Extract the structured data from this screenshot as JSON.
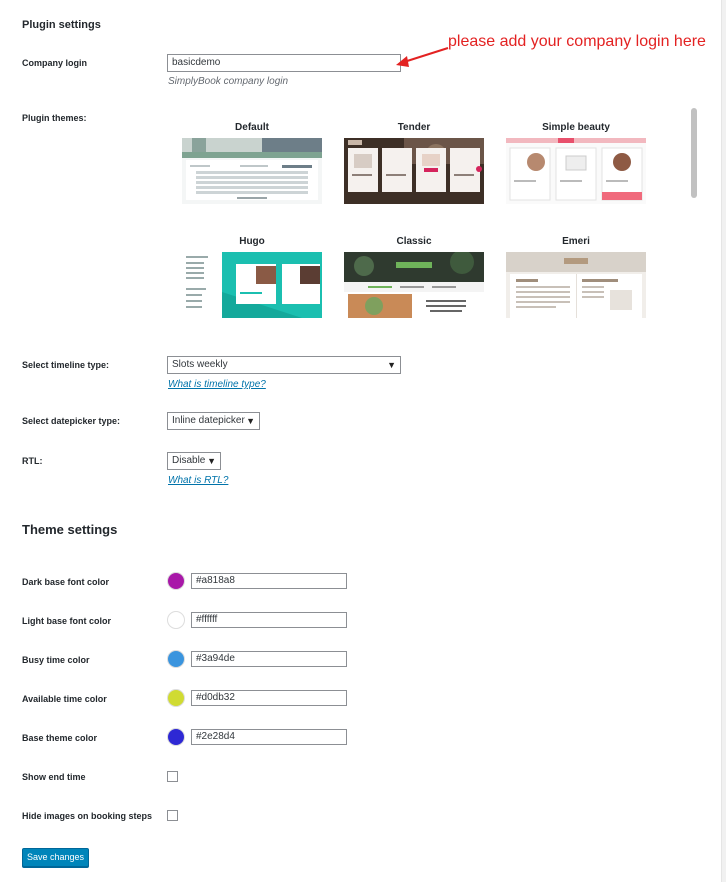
{
  "plugin_settings": {
    "heading": "Plugin settings",
    "company_login": {
      "label": "Company login",
      "value": "basicdemo",
      "description": "SimplyBook company login",
      "annotation": "please add your company login here"
    },
    "plugin_themes": {
      "label": "Plugin themes:",
      "themes": [
        {
          "name": "Default"
        },
        {
          "name": "Tender"
        },
        {
          "name": "Simple beauty"
        },
        {
          "name": "Hugo"
        },
        {
          "name": "Classic"
        },
        {
          "name": "Emeri"
        }
      ]
    },
    "timeline": {
      "label": "Select timeline type:",
      "selected": "Slots weekly",
      "help_link": "What is timeline type?"
    },
    "datepicker": {
      "label": "Select datepicker type:",
      "selected": "Inline datepicker"
    },
    "rtl": {
      "label": "RTL:",
      "selected": "Disable",
      "help_link": "What is RTL?"
    }
  },
  "theme_settings": {
    "heading": "Theme settings",
    "colors": [
      {
        "label": "Dark base font color",
        "value": "#a818a8"
      },
      {
        "label": "Light base font color",
        "value": "#ffffff"
      },
      {
        "label": "Busy time color",
        "value": "#3a94de"
      },
      {
        "label": "Available time color",
        "value": "#d0db32"
      },
      {
        "label": "Base theme color",
        "value": "#2e28d4"
      }
    ],
    "show_end_time": {
      "label": "Show end time",
      "checked": false
    },
    "hide_images": {
      "label": "Hide images on booking steps",
      "checked": false
    },
    "save_label": "Save changes"
  },
  "icons": {
    "dropdown": "triangle-down-icon",
    "arrow": "red-arrow-icon"
  },
  "accent_colors": {
    "annotation": "#e32222",
    "link": "#0073aa",
    "button": "#0085ba"
  }
}
